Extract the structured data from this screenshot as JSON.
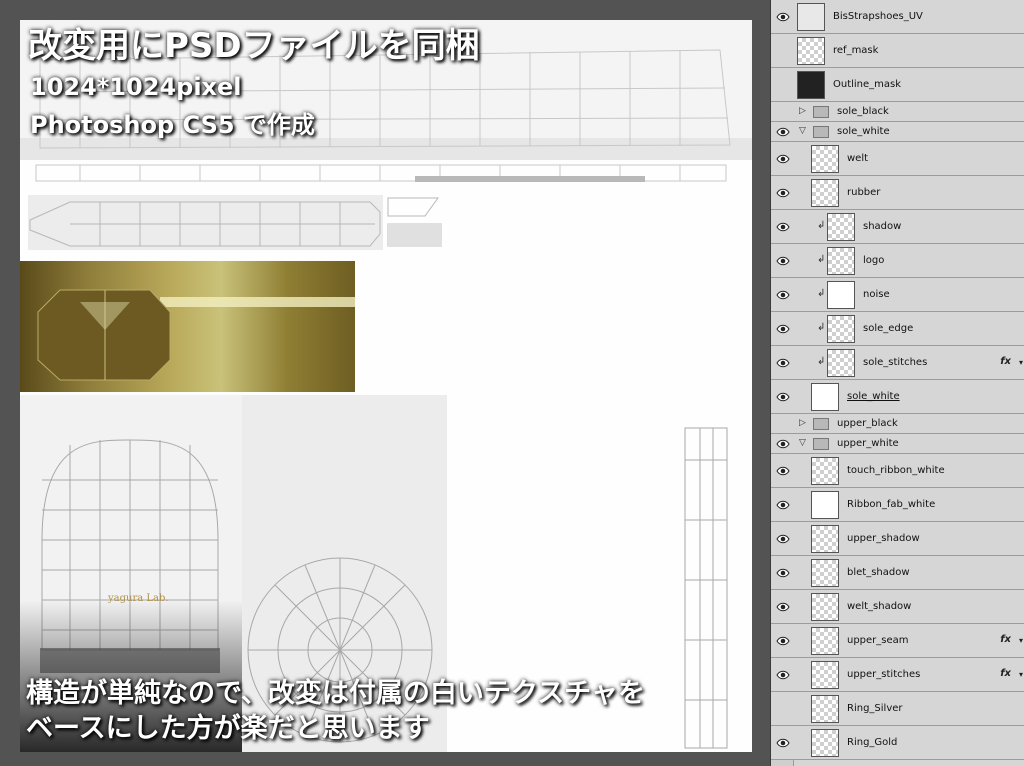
{
  "overlay": {
    "title": "改変用にPSDファイルを同梱",
    "resolution": "1024*1024pixel",
    "software": "Photoshop CS5 で作成",
    "note_line1": "構造が単純なので、改変は付属の白いテクスチャを",
    "note_line2": "ベースにした方が楽だと思います"
  },
  "texture": {
    "logo_text": "yagura Lab."
  },
  "layers": [
    {
      "name": "BisStrapshoes_UV",
      "type": "layer",
      "visible": true,
      "thumb": "uv"
    },
    {
      "name": "ref_mask",
      "type": "layer",
      "visible": false,
      "thumb": "mask"
    },
    {
      "name": "Outline_mask",
      "type": "layer",
      "visible": false,
      "thumb": "dark"
    },
    {
      "name": "sole_black",
      "type": "group",
      "visible": false,
      "expanded": false
    },
    {
      "name": "sole_white",
      "type": "group",
      "visible": true,
      "expanded": true
    },
    {
      "name": "welt",
      "type": "layer",
      "visible": true,
      "thumb": "checker"
    },
    {
      "name": "rubber",
      "type": "layer",
      "visible": true,
      "thumb": "checker"
    },
    {
      "name": "shadow",
      "type": "layer",
      "visible": true,
      "thumb": "checker",
      "clipped": true
    },
    {
      "name": "logo",
      "type": "layer",
      "visible": true,
      "thumb": "checker",
      "clipped": true
    },
    {
      "name": "noise",
      "type": "layer",
      "visible": true,
      "thumb": "white",
      "clipped": true
    },
    {
      "name": "sole_edge",
      "type": "layer",
      "visible": true,
      "thumb": "checker",
      "clipped": true
    },
    {
      "name": "sole_stitches",
      "type": "layer",
      "visible": true,
      "thumb": "checker",
      "clipped": true,
      "fx": "fx"
    },
    {
      "name": "sole_white",
      "type": "layer",
      "visible": true,
      "thumb": "white"
    },
    {
      "name": "upper_black",
      "type": "group",
      "visible": false,
      "expanded": false
    },
    {
      "name": "upper_white",
      "type": "group",
      "visible": true,
      "expanded": true
    },
    {
      "name": "touch_ribbon_white",
      "type": "layer",
      "visible": true,
      "thumb": "checker"
    },
    {
      "name": "Ribbon_fab_white",
      "type": "layer",
      "visible": true,
      "thumb": "white"
    },
    {
      "name": "upper_shadow",
      "type": "layer",
      "visible": true,
      "thumb": "checker"
    },
    {
      "name": "blet_shadow",
      "type": "layer",
      "visible": true,
      "thumb": "checker"
    },
    {
      "name": "welt_shadow",
      "type": "layer",
      "visible": true,
      "thumb": "checker"
    },
    {
      "name": "upper_seam",
      "type": "layer",
      "visible": true,
      "thumb": "checker",
      "fx": "fx"
    },
    {
      "name": "upper_stitches",
      "type": "layer",
      "visible": true,
      "thumb": "checker",
      "fx": "fx"
    },
    {
      "name": "Ring_Silver",
      "type": "layer",
      "visible": false,
      "thumb": "checker"
    },
    {
      "name": "Ring_Gold",
      "type": "layer",
      "visible": true,
      "thumb": "checker"
    }
  ]
}
